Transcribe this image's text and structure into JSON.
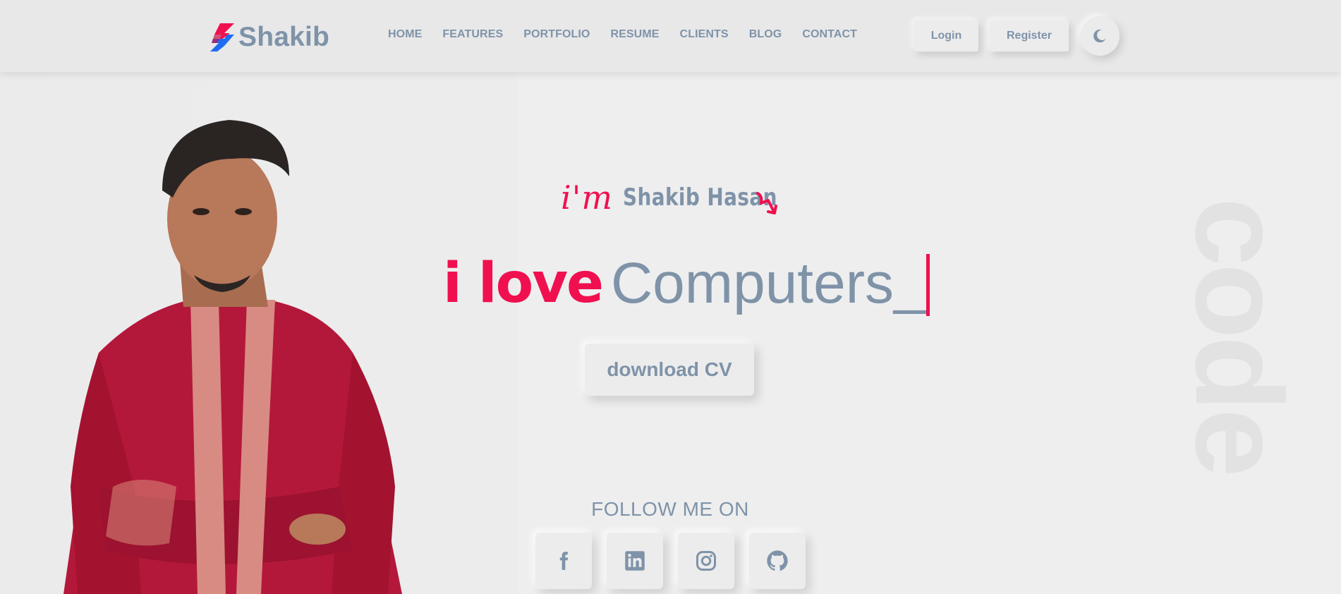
{
  "brand": {
    "name": "Shakib",
    "logo_colors": [
      "#f0104f",
      "#1e6cf2"
    ]
  },
  "nav": {
    "items": [
      {
        "label": "HOME"
      },
      {
        "label": "FEATURES"
      },
      {
        "label": "PORTFOLIO"
      },
      {
        "label": "RESUME"
      },
      {
        "label": "CLIENTS"
      },
      {
        "label": "BLOG"
      },
      {
        "label": "CONTACT"
      }
    ]
  },
  "auth": {
    "login_label": "Login",
    "register_label": "Register"
  },
  "theme_toggle": {
    "icon": "moon-icon"
  },
  "hero": {
    "greeting": "i'm",
    "name": "Shakib Hasan",
    "arrow_icon": "curved-arrow-down-icon",
    "love_prefix": "i love",
    "typed_word": "Computers",
    "typed_suffix": "_",
    "cv_button_label": "download CV",
    "background_word": "code"
  },
  "social": {
    "title": "FOLLOW ME ON",
    "links": [
      {
        "icon": "facebook-icon"
      },
      {
        "icon": "linkedin-icon"
      },
      {
        "icon": "instagram-icon"
      },
      {
        "icon": "github-icon"
      }
    ]
  },
  "colors": {
    "accent": "#f0104f",
    "text_muted": "#7f93a8",
    "background": "#eeeeef"
  }
}
